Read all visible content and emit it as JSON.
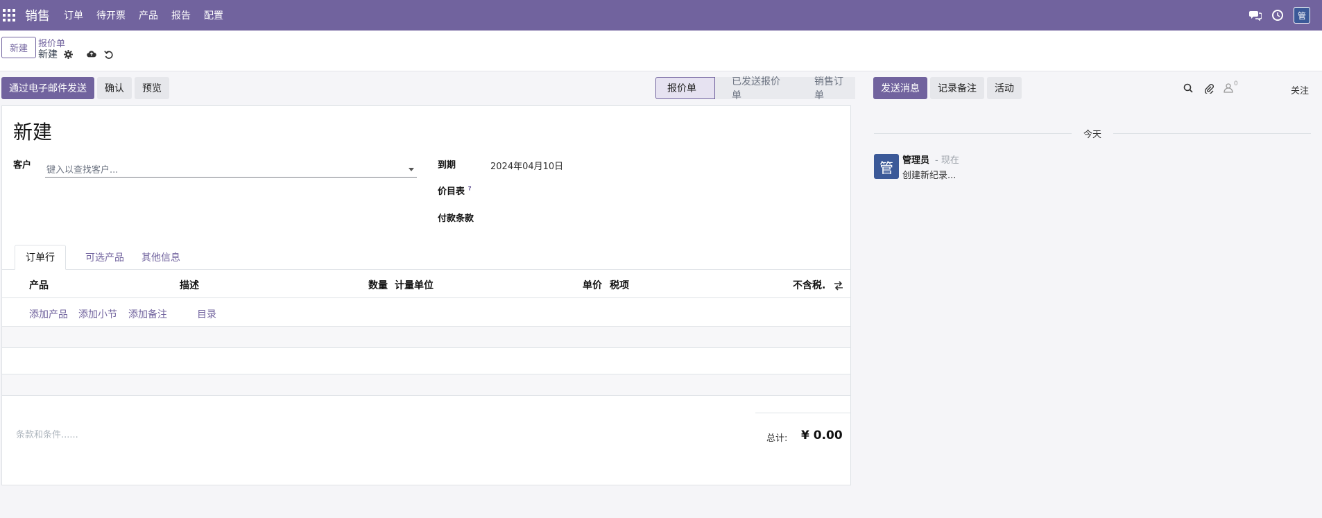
{
  "navbar": {
    "app_name": "销售",
    "menu": [
      "订单",
      "待开票",
      "产品",
      "报告",
      "配置"
    ],
    "avatar_initial": "管",
    "icons": [
      "apps-icon",
      "chat-icon",
      "clock-icon"
    ]
  },
  "control_panel": {
    "new_button": "新建",
    "breadcrumb_parent": "报价单",
    "breadcrumb_current": "新建",
    "icons": [
      "gear-icon",
      "cloud-upload-icon",
      "undo-icon"
    ]
  },
  "actions": {
    "send_email": "通过电子邮件发送",
    "confirm": "确认",
    "preview": "预览"
  },
  "status": {
    "stages": [
      "报价单",
      "已发送报价单",
      "销售订单"
    ],
    "active": "报价单"
  },
  "form": {
    "title": "新建",
    "customer_label": "客户",
    "customer_placeholder": "键入以查找客户...",
    "due_label": "到期",
    "due_value": "2024年04月10日",
    "pricelist_label": "价目表",
    "pricelist_help": "?",
    "payment_terms_label": "付款条款"
  },
  "tabs": [
    "订单行",
    "可选产品",
    "其他信息"
  ],
  "order_lines": {
    "headers": {
      "product": "产品",
      "description": "描述",
      "quantity": "数量",
      "uom": "计量单位",
      "unit_price": "单价",
      "taxes": "税项",
      "subtotal": "不含税."
    },
    "links": [
      "添加产品",
      "添加小节",
      "添加备注",
      "目录"
    ]
  },
  "footer": {
    "terms_placeholder": "条款和条件......",
    "total_label": "总计:",
    "total_value": "¥ 0.00"
  },
  "chatter": {
    "send_message": "发送消息",
    "log_note": "记录备注",
    "activity": "活动",
    "follower_count": "0",
    "follow": "关注",
    "date_separator": "今天",
    "message": {
      "avatar": "管",
      "author": "管理员",
      "time": "- 现在",
      "body": "创建新纪录..."
    }
  },
  "colors": {
    "brand": "#71639e",
    "avatar": "#3b5998"
  }
}
